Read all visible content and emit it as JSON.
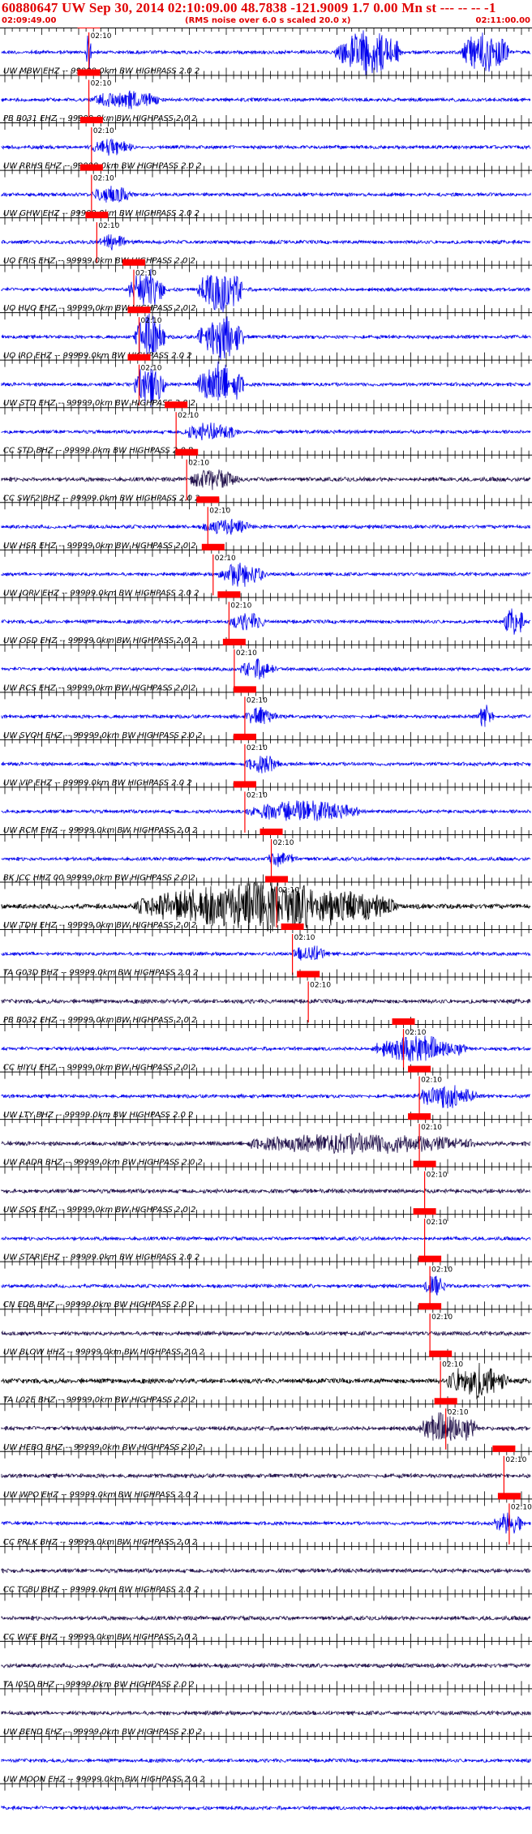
{
  "header": {
    "title": "60880647 UW Sep 30, 2014 02:10:09.00   48.7838 -121.9009  1.7 0.00 Mn st --- -- --   -1",
    "start_time": "02:09:49.00",
    "note": "(RMS noise over 6.0 s scaled 20.0 x)",
    "end_time": "02:11:00.00"
  },
  "pick_label": "02:10",
  "colors": {
    "header": "#e00000",
    "pick": "#ff0000",
    "blue": "#0000ee",
    "dark": "#20104a",
    "black": "#000000"
  },
  "traces": [
    {
      "label": "",
      "color": "blue",
      "bursts": [
        [
          0.16,
          0.17,
          4.0
        ],
        [
          0.63,
          0.76,
          4.0
        ],
        [
          0.87,
          0.96,
          4.0
        ]
      ],
      "pick": 0.165
    },
    {
      "label": "UW MBW EHZ -- 99999.0km BW  HIGHPASS  2.0  2",
      "color": "blue",
      "bursts": [
        [
          0.17,
          0.3,
          1.6
        ]
      ],
      "pick": 0.165
    },
    {
      "label": "PB B031 EHZ -- 99999.0km BW  HIGHPASS  2.0  2",
      "color": "blue",
      "bursts": [
        [
          0.17,
          0.25,
          1.4
        ]
      ],
      "pick": 0.17
    },
    {
      "label": "UW RRHS EHZ -- 99999.0km BW  HIGHPASS  2.0  2",
      "color": "blue",
      "bursts": [
        [
          0.17,
          0.25,
          1.3
        ]
      ],
      "pick": 0.17
    },
    {
      "label": "UW GHW EHZ -- 99999.0km BW  HIGHPASS  2.0  2",
      "color": "blue",
      "bursts": [
        [
          0.18,
          0.24,
          1.2
        ]
      ],
      "pick": 0.18
    },
    {
      "label": "UO FRIS EHZ -- 99999.0km BW  HIGHPASS  2.0  2",
      "color": "blue",
      "bursts": [
        [
          0.24,
          0.31,
          4.0
        ],
        [
          0.37,
          0.46,
          4.0
        ]
      ],
      "pick": 0.25
    },
    {
      "label": "UO HUO EHZ -- 99999.0km BW  HIGHPASS  2.0  2",
      "color": "blue",
      "bursts": [
        [
          0.25,
          0.31,
          4.0
        ],
        [
          0.37,
          0.46,
          4.0
        ]
      ],
      "pick": 0.26
    },
    {
      "label": "UO IRO EHZ -- 99999.0km BW  HIGHPASS  2.0  2",
      "color": "blue",
      "bursts": [
        [
          0.25,
          0.31,
          4.0
        ],
        [
          0.37,
          0.46,
          4.0
        ]
      ],
      "pick": 0.26
    },
    {
      "label": "UW STD EHZ -- 99999.0km BW  HIGHPASS  2.0  2",
      "color": "blue",
      "bursts": [
        [
          0.34,
          0.45,
          1.5
        ]
      ],
      "pick": 0.33
    },
    {
      "label": "CC STD BHZ -- 99999.0km BW  HIGHPASS  2.0  2",
      "color": "dark",
      "bursts": [
        [
          0.35,
          0.45,
          1.3
        ]
      ],
      "pick": 0.35
    },
    {
      "label": "CC SWF2 BHZ -- 99999.0km BW  HIGHPASS  2.0  2",
      "color": "blue",
      "bursts": [
        [
          0.38,
          0.47,
          1.3
        ]
      ],
      "pick": 0.39
    },
    {
      "label": "UW HSR EHZ -- 99999.0km BW  HIGHPASS  2.0  2",
      "color": "blue",
      "bursts": [
        [
          0.41,
          0.5,
          2.2
        ]
      ],
      "pick": 0.4
    },
    {
      "label": "UW JORV EHZ -- 99999.0km BW  HIGHPASS  2.0  2",
      "color": "blue",
      "bursts": [
        [
          0.43,
          0.5,
          1.4
        ],
        [
          0.95,
          0.99,
          2.5
        ]
      ],
      "pick": 0.43
    },
    {
      "label": "UW OSD EHZ -- 99999.0km BW  HIGHPASS  2.0  2",
      "color": "blue",
      "bursts": [
        [
          0.45,
          0.52,
          1.6
        ]
      ],
      "pick": 0.44
    },
    {
      "label": "UW RCS EHZ -- 99999.0km BW  HIGHPASS  2.0  2",
      "color": "blue",
      "bursts": [
        [
          0.46,
          0.52,
          1.5
        ],
        [
          0.9,
          0.93,
          2.0
        ]
      ],
      "pick": 0.46
    },
    {
      "label": "UW SVOH EHZ -- 99999.0km BW  HIGHPASS  2.0  2",
      "color": "blue",
      "bursts": [
        [
          0.46,
          0.53,
          1.4
        ]
      ],
      "pick": 0.46
    },
    {
      "label": "UW VIP EHZ -- 99999.0km BW  HIGHPASS  2.0  2",
      "color": "blue",
      "bursts": [
        [
          0.46,
          0.68,
          1.8
        ]
      ],
      "pick": 0.46
    },
    {
      "label": "UW RCM EHZ -- 99999.0km BW  HIGHPASS  2.0  2",
      "color": "blue",
      "bursts": [
        [
          0.5,
          0.56,
          1.3
        ]
      ],
      "pick": 0.51
    },
    {
      "label": "BK JCC HHZ 00 99999.0km BW  HIGHPASS  2.0  2",
      "color": "black",
      "bursts": [
        [
          0.25,
          0.75,
          3.0
        ]
      ],
      "pick": 0.52
    },
    {
      "label": "UW TDH EHZ -- 99999.0km BW  HIGHPASS  2.0  2",
      "color": "blue",
      "bursts": [
        [
          0.55,
          0.62,
          1.4
        ]
      ],
      "pick": 0.55
    },
    {
      "label": "TA G03D BHZ -- 99999.0km BW  HIGHPASS  2.0  2",
      "color": "dark",
      "bursts": [],
      "pick": 0.58
    },
    {
      "label": "PB B032 EHZ -- 99999.0km BW  HIGHPASS  2.0  2",
      "color": "blue",
      "bursts": [
        [
          0.7,
          0.88,
          2.2
        ]
      ],
      "pick": 0.76
    },
    {
      "label": "CC HIYU EHZ -- 99999.0km BW  HIGHPASS  2.0  2",
      "color": "blue",
      "bursts": [
        [
          0.78,
          0.9,
          2.0
        ]
      ],
      "pick": 0.79
    },
    {
      "label": "UW LTY BHZ -- 99999.0km BW  HIGHPASS  2.0  2",
      "color": "dark",
      "bursts": [
        [
          0.45,
          0.9,
          1.4
        ]
      ],
      "pick": 0.79
    },
    {
      "label": "UW RADR BHZ -- 99999.0km BW  HIGHPASS  2.0  2",
      "color": "dark",
      "bursts": [],
      "pick": 0.8
    },
    {
      "label": "UW SOS EHZ -- 99999.0km BW  HIGHPASS  2.0  2",
      "color": "blue",
      "bursts": [],
      "pick": 0.8
    },
    {
      "label": "UW STAR EHZ -- 99999.0km BW  HIGHPASS  2.0  2",
      "color": "blue",
      "bursts": [
        [
          0.8,
          0.84,
          2.0
        ]
      ],
      "pick": 0.81
    },
    {
      "label": "CN EDB BHZ -- 99999.0km BW  HIGHPASS  2.0  2",
      "color": "dark",
      "bursts": [],
      "pick": 0.81
    },
    {
      "label": "UW BLOW HHZ -- 99999.0km BW  HIGHPASS  2.0  2",
      "color": "black",
      "bursts": [
        [
          0.84,
          0.96,
          2.2
        ]
      ],
      "pick": 0.83
    },
    {
      "label": "TA L02E BHZ -- 99999.0km BW  HIGHPASS  2.0  2",
      "color": "dark",
      "bursts": [
        [
          0.79,
          0.9,
          2.5
        ]
      ],
      "pick": 0.84
    },
    {
      "label": "UW HEBO BHZ -- 99999.0km BW  HIGHPASS  2.0  2",
      "color": "dark",
      "bursts": [],
      "pick": 0.95
    },
    {
      "label": "UW WPO EHZ -- 99999.0km BW  HIGHPASS  2.0  2",
      "color": "blue",
      "bursts": [
        [
          0.93,
          0.99,
          1.8
        ]
      ],
      "pick": 0.96
    },
    {
      "label": "CC PRLK BHZ -- 99999.0km BW  HIGHPASS  2.0  2",
      "color": "dark",
      "bursts": [],
      "pick": null
    },
    {
      "label": "CC TCBU BHZ -- 99999.0km BW  HIGHPASS  2.0  2",
      "color": "dark",
      "bursts": [],
      "pick": null
    },
    {
      "label": "CC WIFE BHZ -- 99999.0km BW  HIGHPASS  2.0  2",
      "color": "dark",
      "bursts": [],
      "pick": null
    },
    {
      "label": "TA I05D BHZ -- 99999.0km BW  HIGHPASS  2.0  2",
      "color": "dark",
      "bursts": [],
      "pick": null
    },
    {
      "label": "UW BEND EHZ -- 99999.0km BW  HIGHPASS  2.0  2",
      "color": "blue",
      "bursts": [],
      "pick": null
    },
    {
      "label": "UW MOON EHZ -- 99999.0km BW  HIGHPASS  2.0  2",
      "color": "blue",
      "bursts": [],
      "pick": null
    }
  ]
}
